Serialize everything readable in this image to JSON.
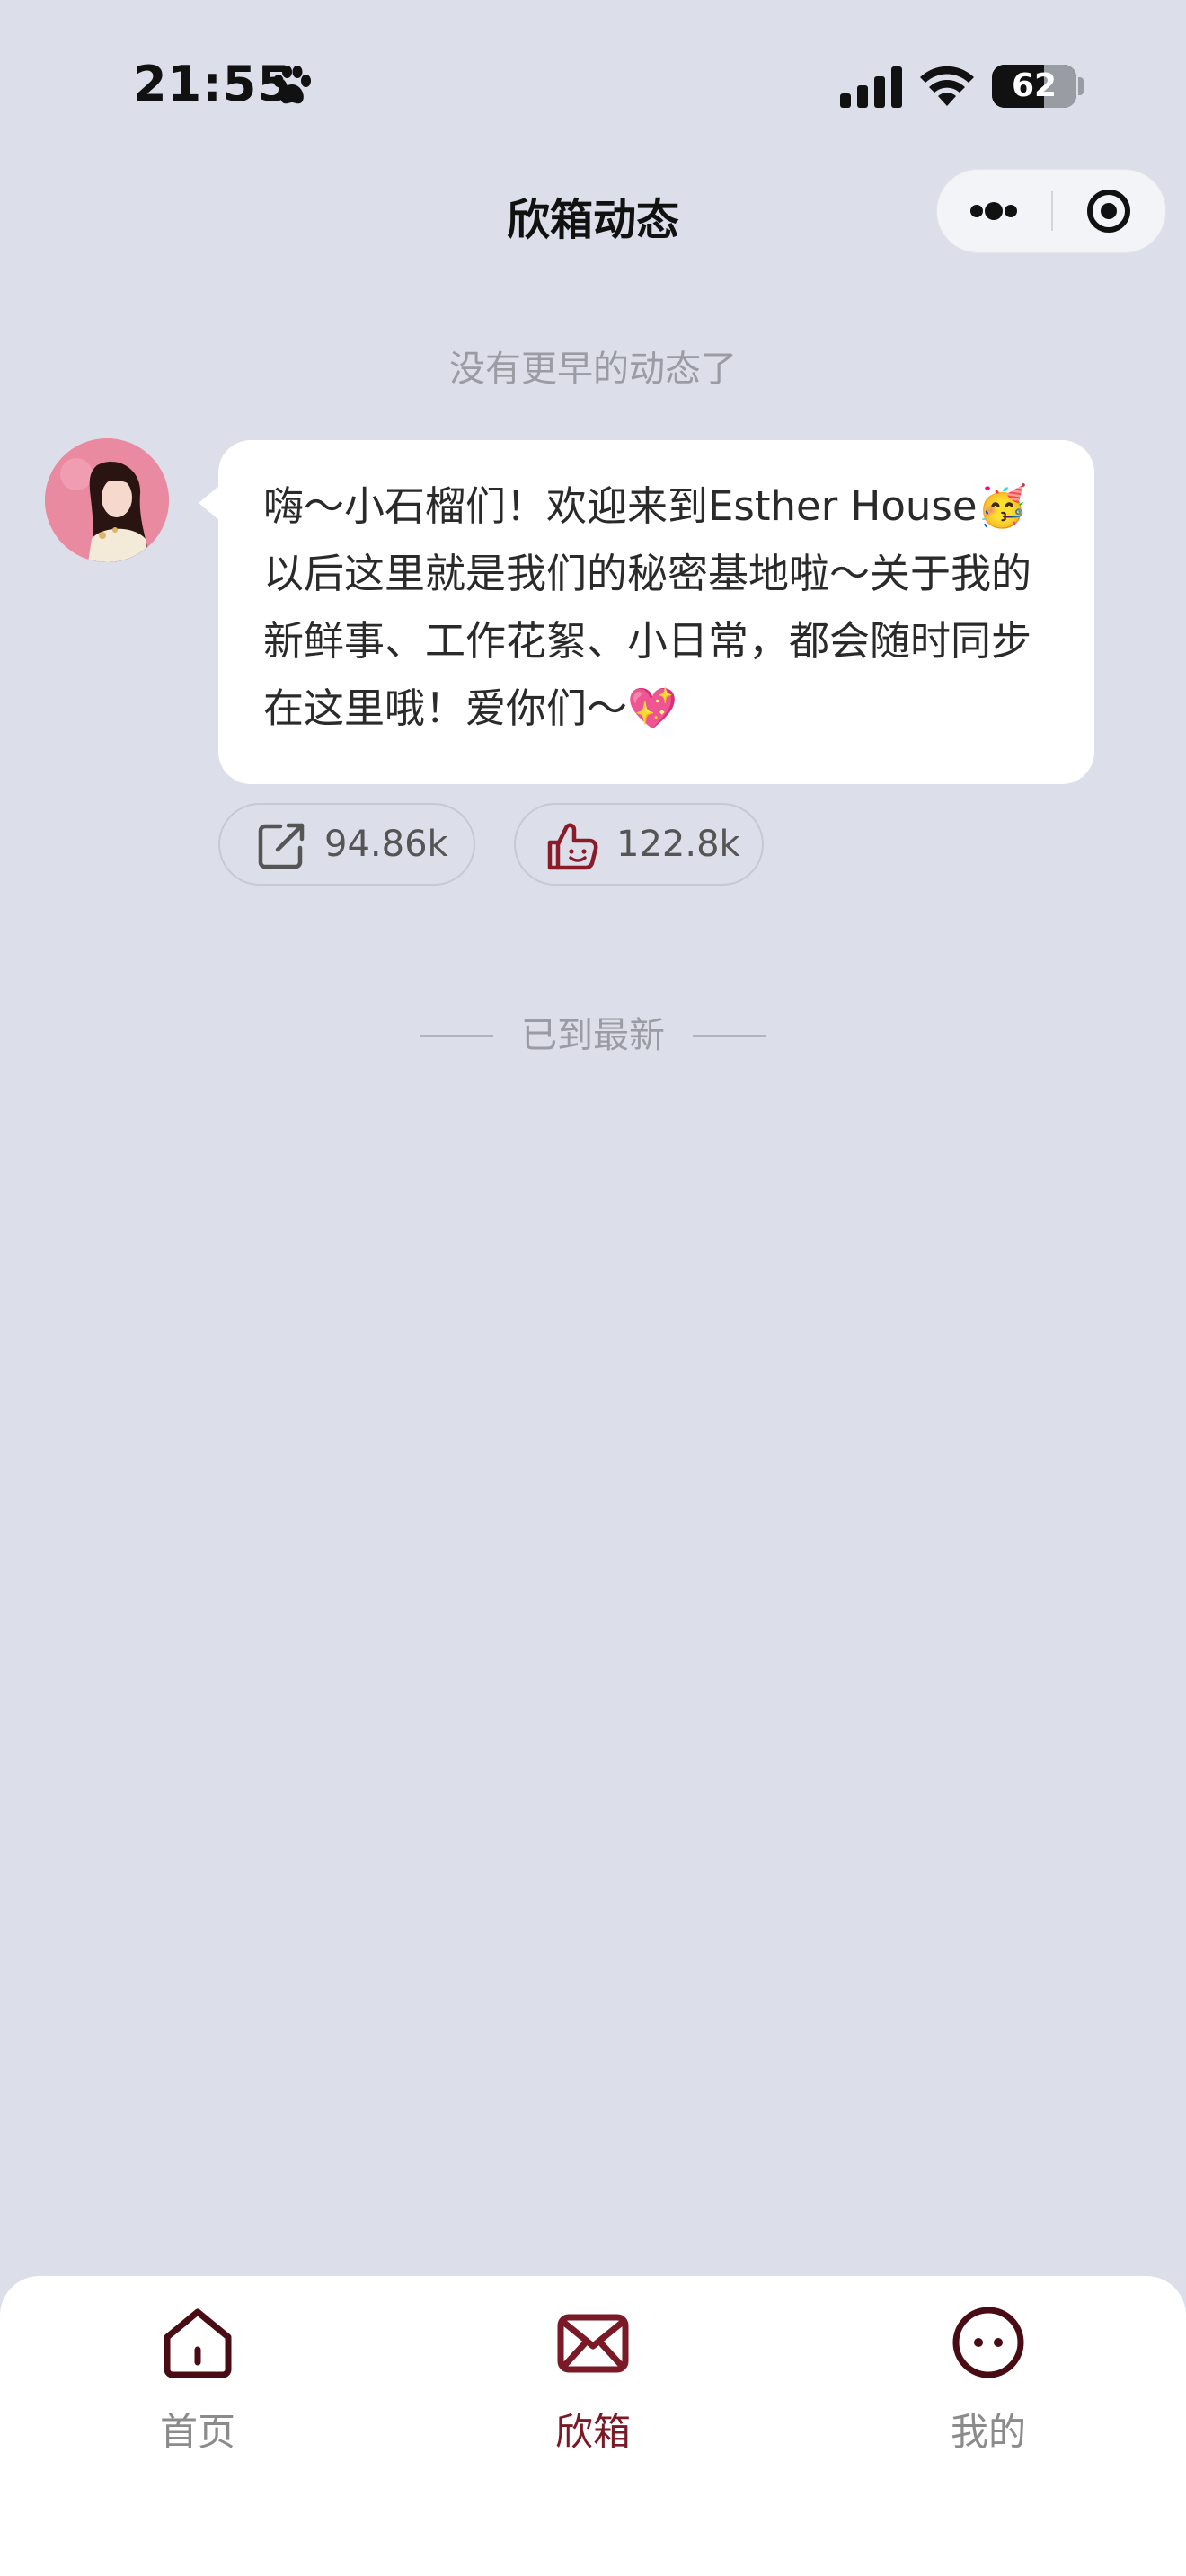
{
  "status_bar": {
    "time": "21:55",
    "battery": "62",
    "battery_level_percent": 62
  },
  "nav": {
    "title": "欣箱动态"
  },
  "feed": {
    "top_hint": "没有更早的动态了",
    "post": {
      "text": "嗨～小石榴们！欢迎来到Esther House🥳 以后这里就是我们的秘密基地啦～关于我的新鲜事、工作花絮、小日常，都会随时同步在这里哦！爱你们～💖",
      "shares": "94.86k",
      "likes": "122.8k"
    },
    "end_hint": "已到最新"
  },
  "tabbar": {
    "items": [
      {
        "label": "首页",
        "icon": "home-icon"
      },
      {
        "label": "欣箱",
        "icon": "mail-icon",
        "active": true
      },
      {
        "label": "我的",
        "icon": "face-icon"
      }
    ]
  },
  "colors": {
    "background": "#dcdfea",
    "accent": "#7a1a26",
    "icon_dark": "#4a0c14",
    "bubble": "#ffffff",
    "muted_text": "#9a9ba3"
  }
}
